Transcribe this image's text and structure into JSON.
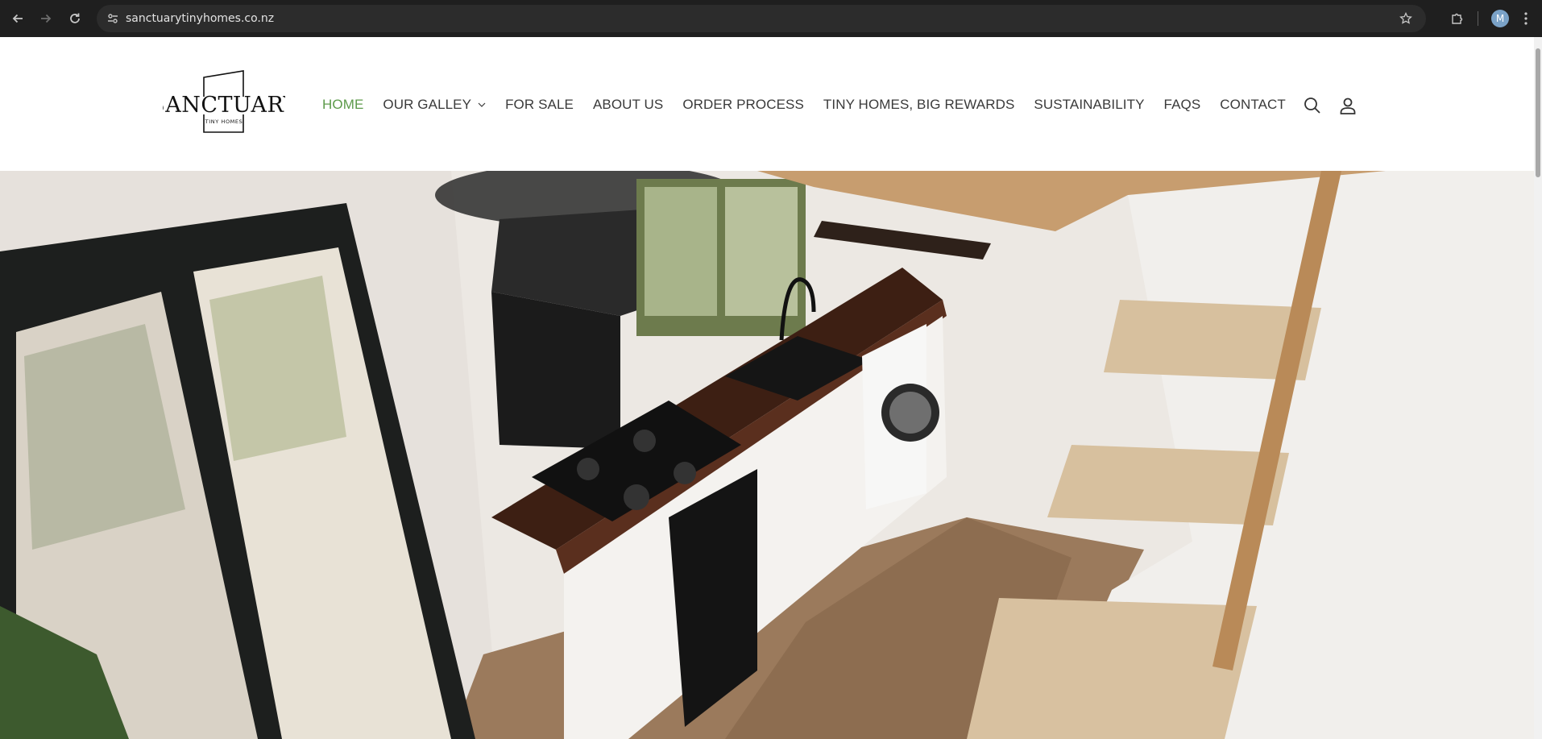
{
  "browser": {
    "url": "sanctuarytinyhomes.co.nz",
    "profile_initial": "M",
    "icons": {
      "back": "arrow-left-icon",
      "forward": "arrow-right-icon",
      "reload": "reload-icon",
      "site_info": "tune-icon",
      "bookmark": "star-icon",
      "extensions": "puzzle-icon",
      "menu": "kebab-menu-icon"
    }
  },
  "logo": {
    "text": "SANCTUARY",
    "subtext": "TINY HOMES"
  },
  "nav": {
    "items": [
      {
        "label": "HOME",
        "active": true
      },
      {
        "label": "OUR GALLEY",
        "has_dropdown": true
      },
      {
        "label": "FOR SALE"
      },
      {
        "label": "ABOUT US"
      },
      {
        "label": "ORDER PROCESS"
      },
      {
        "label": "TINY HOMES, BIG REWARDS"
      },
      {
        "label": "SUSTAINABILITY"
      },
      {
        "label": "FAQS"
      },
      {
        "label": "CONTACT"
      }
    ],
    "active_color": "#5c9a4a",
    "text_color": "#3a3a3a"
  },
  "header_icons": {
    "search": "search-icon",
    "account": "account-icon"
  },
  "hero": {
    "image_subject": "tiny-home-kitchen-interior-photo"
  }
}
